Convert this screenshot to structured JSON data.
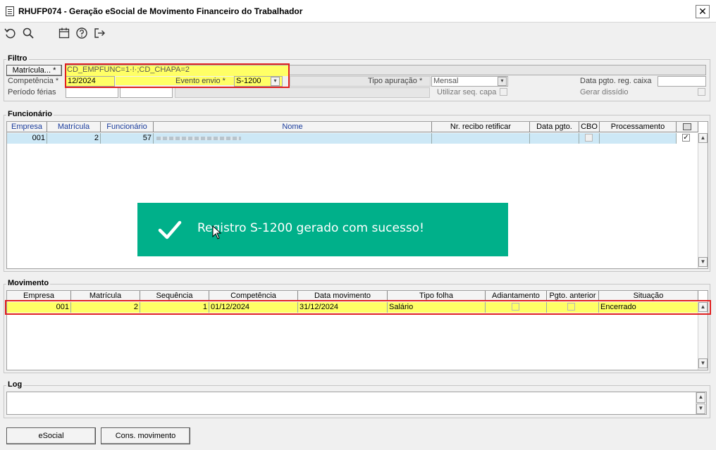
{
  "window": {
    "title": "RHUFP074 - Geração eSocial de Movimento Financeiro do Trabalhador",
    "close_label": "✕"
  },
  "toolbar": {
    "icons": [
      "undo-icon",
      "search-icon",
      "calendar-icon",
      "help-icon",
      "exit-icon"
    ]
  },
  "filtro": {
    "title": "Filtro",
    "matricula_button": "Matrícula... *",
    "matricula_value": "CD_EMPFUNC=1·!·;CD_CHAPA=2",
    "competencia_label": "Competência *",
    "competencia_value": "12/2024",
    "evento_label": "Evento envio *",
    "evento_value": "S-1200",
    "tipo_apuracao_label": "Tipo apuração *",
    "tipo_apuracao_value": "Mensal",
    "data_pgto_caixa_label": "Data pgto. reg. caixa",
    "data_pgto_caixa_value": "",
    "periodo_ferias_label": "Período férias",
    "utilizar_seq_capa_label": "Utilizar seq. capa",
    "gerar_dissidio_label": "Gerar dissídio"
  },
  "funcionario": {
    "title": "Funcionário",
    "columns": [
      "Empresa",
      "Matrícula",
      "Funcionário",
      "Nome",
      "Nr. recibo retificar",
      "Data pgto.",
      "CBO",
      "Processamento"
    ],
    "rows": [
      {
        "empresa": "001",
        "matricula": "2",
        "funcionario": "57",
        "nome": "",
        "recibo": "",
        "data_pgto": "",
        "processamento": "",
        "selected": true
      }
    ]
  },
  "movimento": {
    "title": "Movimento",
    "columns": [
      "Empresa",
      "Matrícula",
      "Sequência",
      "Competência",
      "Data movimento",
      "Tipo folha",
      "Adiantamento",
      "Pgto. anterior",
      "Situação"
    ],
    "rows": [
      {
        "empresa": "001",
        "matricula": "2",
        "sequencia": "1",
        "competencia": "01/12/2024",
        "data_movimento": "31/12/2024",
        "tipo_folha": "Salário",
        "situacao": "Encerrado"
      }
    ]
  },
  "log": {
    "title": "Log",
    "value": ""
  },
  "buttons": {
    "esocial": "eSocial",
    "cons_movimento": "Cons. movimento"
  },
  "toast": {
    "message": "Registro S-1200 gerado com sucesso!",
    "color": "#00b08a"
  },
  "colors": {
    "highlight": "#ffff66",
    "selected_row": "#cde8f6",
    "red_outline": "#e02020"
  }
}
